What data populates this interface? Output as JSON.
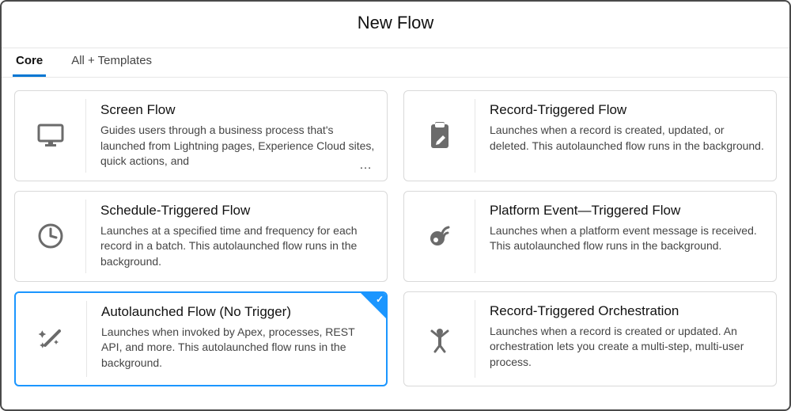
{
  "title": "New Flow",
  "tabs": [
    {
      "label": "Core",
      "active": true
    },
    {
      "label": "All + Templates",
      "active": false
    }
  ],
  "cards": [
    {
      "id": "screen-flow",
      "icon": "monitor-icon",
      "title": "Screen Flow",
      "desc": "Guides users through a business process that's launched from Lightning pages, Experience Cloud sites, quick actions, and",
      "truncated": true,
      "selected": false
    },
    {
      "id": "record-triggered-flow",
      "icon": "clipboard-edit-icon",
      "title": "Record-Triggered Flow",
      "desc": "Launches when a record is created, updated, or deleted. This autolaunched flow runs in the background.",
      "truncated": false,
      "selected": false
    },
    {
      "id": "schedule-triggered-flow",
      "icon": "clock-icon",
      "title": "Schedule-Triggered Flow",
      "desc": "Launches at a specified time and frequency for each record in a batch. This autolaunched flow runs in the background.",
      "truncated": false,
      "selected": false
    },
    {
      "id": "platform-event-triggered-flow",
      "icon": "satellite-icon",
      "title": "Platform Event—Triggered Flow",
      "desc": "Launches when a platform event message is received. This autolaunched flow runs in the background.",
      "truncated": false,
      "selected": false
    },
    {
      "id": "autolaunched-flow",
      "icon": "wand-icon",
      "title": "Autolaunched Flow (No Trigger)",
      "desc": "Launches when invoked by Apex, processes, REST API, and more. This autolaunched flow runs in the background.",
      "truncated": false,
      "selected": true
    },
    {
      "id": "record-triggered-orchestration",
      "icon": "orchestration-icon",
      "title": "Record-Triggered Orchestration",
      "desc": "Launches when a record is created or updated. An orchestration lets you create a multi-step, multi-user process.",
      "truncated": false,
      "selected": false
    }
  ],
  "ellipsis": "…"
}
